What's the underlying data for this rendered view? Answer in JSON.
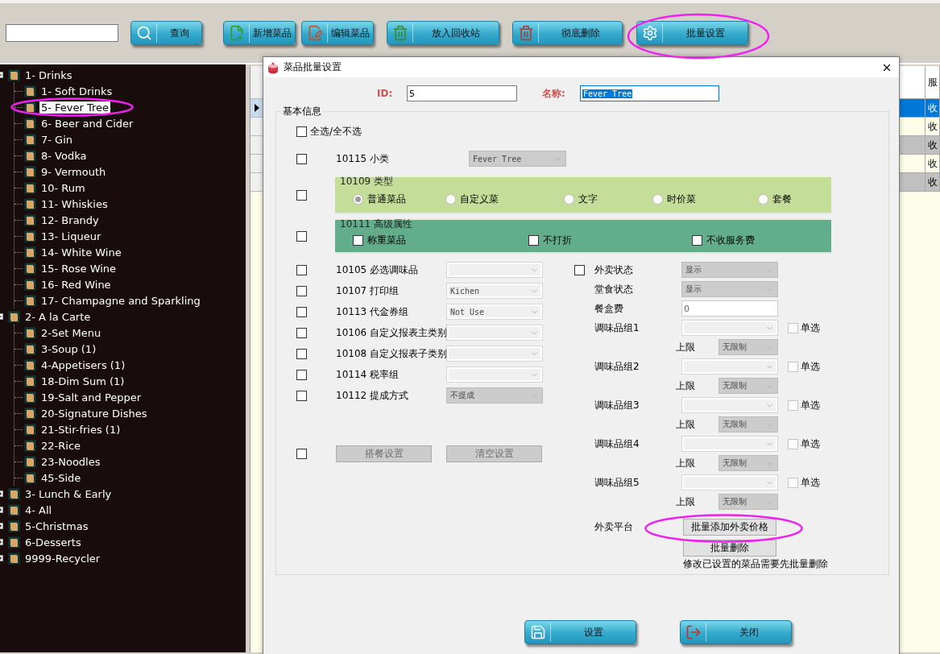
{
  "toolbar": {
    "buttons": [
      {
        "label": "查询"
      },
      {
        "label": "新增菜品"
      },
      {
        "label": "编辑菜品"
      },
      {
        "label": "放入回收站"
      },
      {
        "label": "彻底删除"
      },
      {
        "label": "批量设置"
      }
    ]
  },
  "tree": [
    {
      "label": "1- Drinks",
      "selected": false,
      "expanded": true,
      "children": [
        {
          "label": "1- Soft Drinks",
          "selected": false
        },
        {
          "label": "5- Fever Tree",
          "selected": true
        },
        {
          "label": "6- Beer and Cider",
          "selected": false
        },
        {
          "label": "7- Gin",
          "selected": false
        },
        {
          "label": "8- Vodka",
          "selected": false
        },
        {
          "label": "9- Vermouth",
          "selected": false
        },
        {
          "label": "10- Rum",
          "selected": false
        },
        {
          "label": "11- Whiskies",
          "selected": false
        },
        {
          "label": "12- Brandy",
          "selected": false
        },
        {
          "label": "13- Liqueur",
          "selected": false
        },
        {
          "label": "14- White Wine",
          "selected": false
        },
        {
          "label": "15- Rose Wine",
          "selected": false
        },
        {
          "label": "16- Red Wine",
          "selected": false
        },
        {
          "label": "17- Champagne and Sparkling",
          "selected": false
        }
      ]
    },
    {
      "label": "2- A la Carte",
      "selected": false,
      "expanded": true,
      "children": [
        {
          "label": "2-Set Menu",
          "selected": false
        },
        {
          "label": "3-Soup (1)",
          "selected": false
        },
        {
          "label": "4-Appetisers (1)",
          "selected": false
        },
        {
          "label": "18-Dim Sum (1)",
          "selected": false
        },
        {
          "label": "19-Salt and Pepper",
          "selected": false
        },
        {
          "label": "20-Signature Dishes",
          "selected": false
        },
        {
          "label": "21-Stir-fries (1)",
          "selected": false
        },
        {
          "label": "22-Rice",
          "selected": false
        },
        {
          "label": "23-Noodles",
          "selected": false
        },
        {
          "label": "45-Side",
          "selected": false
        }
      ]
    },
    {
      "label": "3- Lunch & Early",
      "selected": false,
      "expanded": false
    },
    {
      "label": "4- All",
      "selected": false,
      "expanded": false
    },
    {
      "label": "5-Christmas",
      "selected": false,
      "expanded": false
    },
    {
      "label": "6-Desserts",
      "selected": false,
      "expanded": false
    },
    {
      "label": "9999-Recycler",
      "selected": false,
      "expanded": false
    }
  ],
  "table": {
    "columns": [
      "服"
    ],
    "rows": [
      {
        "selected": true,
        "cell": "收"
      },
      {
        "selected": false,
        "greyed": false,
        "cell": "收"
      },
      {
        "selected": false,
        "greyed": true,
        "cell": "收"
      },
      {
        "selected": false,
        "greyed": false,
        "cell": "收"
      },
      {
        "selected": false,
        "greyed": true,
        "cell": "收"
      }
    ]
  },
  "dialog": {
    "title": "菜品批量设置",
    "id_label": "ID:",
    "id_value": "5",
    "name_label": "名称:",
    "name_value": "Fever Tree",
    "group_title": "基本信息",
    "select_all": {
      "label": "全选/全不选",
      "checked": false
    },
    "subcategory": {
      "checked": false,
      "code": "10115",
      "label": "小类",
      "value": "Fever Tree",
      "disabled": true
    },
    "type_group": {
      "checked": false,
      "code": "10109",
      "label": "类型",
      "options": [
        {
          "label": "普通菜品",
          "selected": true
        },
        {
          "label": "自定义菜",
          "selected": false
        },
        {
          "label": "文字",
          "selected": false
        },
        {
          "label": "时价菜",
          "selected": false
        },
        {
          "label": "套餐",
          "selected": false
        }
      ]
    },
    "attributes_group": {
      "checked": false,
      "code": "10111",
      "label": "高级属性",
      "options": [
        {
          "label": "称重菜品",
          "checked": false
        },
        {
          "label": "不打折",
          "checked": false
        },
        {
          "label": "不收服务费",
          "checked": false
        }
      ]
    },
    "left_fields": [
      {
        "checked": false,
        "code": "10105",
        "label": "必选调味品",
        "disabled": false
      },
      {
        "checked": false,
        "code": "10107",
        "label": "打印组",
        "value": "Kichen",
        "disabled": false
      },
      {
        "checked": false,
        "code": "10113",
        "label": "代金券组",
        "value": "Not Use",
        "disabled": false
      },
      {
        "checked": false,
        "code": "10106",
        "label": "自定义报表主类别",
        "disabled": false
      },
      {
        "checked": false,
        "code": "10108",
        "label": "自定义报表子类别",
        "disabled": false
      },
      {
        "checked": false,
        "code": "10114",
        "label": "税率组",
        "disabled": false
      },
      {
        "checked": false,
        "code": "10112",
        "label": "提成方式",
        "value": "不提成",
        "disabled": true
      }
    ],
    "left_buttons": {
      "checked": false,
      "buttons": [
        {
          "label": "搭餐设置",
          "disabled": true
        },
        {
          "label": "清空设置",
          "disabled": true
        }
      ]
    },
    "takeaway_status": {
      "checked": false,
      "label": "外卖状态",
      "value": "显示",
      "disabled": true
    },
    "dine_in_status": {
      "label": "堂食状态",
      "value": "显示",
      "disabled": true
    },
    "box_fee": {
      "label": "餐盒费",
      "value": "0"
    },
    "seasoning_groups": [
      {
        "label": "调味品组1",
        "single_label": "单选",
        "single_checked": false,
        "limit_label": "上限",
        "limit_value": "无限制"
      },
      {
        "label": "调味品组2",
        "single_label": "单选",
        "single_checked": false,
        "limit_label": "上限",
        "limit_value": "无限制"
      },
      {
        "label": "调味品组3",
        "single_label": "单选",
        "single_checked": false,
        "limit_label": "上限",
        "limit_value": "无限制"
      },
      {
        "label": "调味品组4",
        "single_label": "单选",
        "single_checked": false,
        "limit_label": "上限",
        "limit_value": "无限制"
      },
      {
        "label": "调味品组5",
        "single_label": "单选",
        "single_checked": false,
        "limit_label": "上限",
        "limit_value": "无限制"
      }
    ],
    "platform": {
      "label": "外卖平台",
      "add_button": "批量添加外卖价格",
      "delete_button": "批量删除",
      "note": "修改已设置的菜品需要先批量删除"
    },
    "footer_buttons": [
      {
        "label": "设置"
      },
      {
        "label": "关闭"
      }
    ]
  }
}
